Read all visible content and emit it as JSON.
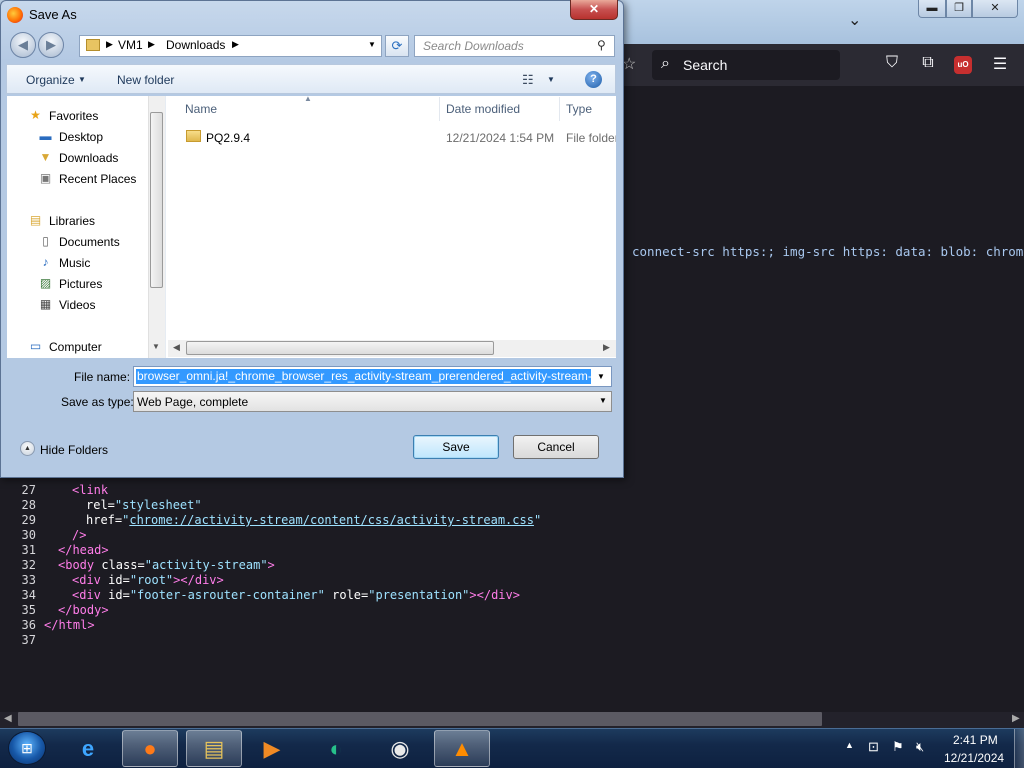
{
  "firefox": {
    "search_placeholder": "Search",
    "csp_text": "connect-src https:; img-src https: data: blob: chrome:;",
    "source_lines": [
      {
        "num": "27",
        "parts": [
          [
            "tag",
            "<link"
          ]
        ],
        "indent": 2
      },
      {
        "num": "28",
        "parts": [
          [
            "attr",
            "rel="
          ],
          [
            "val",
            "\"stylesheet\""
          ]
        ],
        "indent": 3
      },
      {
        "num": "29",
        "parts": [
          [
            "attr",
            "href="
          ],
          [
            "val",
            "\""
          ],
          [
            "link",
            "chrome://activity-stream/content/css/activity-stream.css"
          ],
          [
            "val",
            "\""
          ]
        ],
        "indent": 3
      },
      {
        "num": "30",
        "parts": [
          [
            "tag",
            "/>"
          ]
        ],
        "indent": 2
      },
      {
        "num": "31",
        "parts": [
          [
            "tag",
            "</head>"
          ]
        ],
        "indent": 1
      },
      {
        "num": "32",
        "parts": [
          [
            "tag",
            "<body "
          ],
          [
            "attr",
            "class="
          ],
          [
            "val",
            "\"activity-stream\""
          ],
          [
            "tag",
            ">"
          ]
        ],
        "indent": 1
      },
      {
        "num": "33",
        "parts": [
          [
            "tag",
            "<div "
          ],
          [
            "attr",
            "id="
          ],
          [
            "val",
            "\"root\""
          ],
          [
            "tag",
            "></div>"
          ]
        ],
        "indent": 2
      },
      {
        "num": "34",
        "parts": [
          [
            "tag",
            "<div "
          ],
          [
            "attr",
            "id="
          ],
          [
            "val",
            "\"footer-asrouter-container\""
          ],
          [
            "attr",
            " role="
          ],
          [
            "val",
            "\"presentation\""
          ],
          [
            "tag",
            "></div>"
          ]
        ],
        "indent": 2
      },
      {
        "num": "35",
        "parts": [
          [
            "tag",
            "</body>"
          ]
        ],
        "indent": 1
      },
      {
        "num": "36",
        "parts": [
          [
            "tag",
            "</html>"
          ]
        ],
        "indent": 0
      },
      {
        "num": "37",
        "parts": [],
        "indent": 0
      }
    ]
  },
  "dialog": {
    "title": "Save As",
    "breadcrumb": [
      "VM1",
      "Downloads"
    ],
    "search_placeholder": "Search Downloads",
    "organize_label": "Organize",
    "new_folder_label": "New folder",
    "nav": {
      "favorites_label": "Favorites",
      "favorites": [
        "Desktop",
        "Downloads",
        "Recent Places"
      ],
      "libraries_label": "Libraries",
      "libraries": [
        "Documents",
        "Music",
        "Pictures",
        "Videos"
      ],
      "computer_label": "Computer"
    },
    "columns": [
      "Name",
      "Date modified",
      "Type"
    ],
    "files": [
      {
        "name": "PQ2.9.4",
        "date": "12/21/2024 1:54 PM",
        "type": "File folder"
      }
    ],
    "file_name_label": "File name:",
    "file_name_value": "browser_omni.ja!_chrome_browser_res_activity-stream_prerendered_activity-stream-n",
    "save_type_label": "Save as type:",
    "save_type_value": "Web Page, complete",
    "hide_folders_label": "Hide Folders",
    "save_label": "Save",
    "cancel_label": "Cancel"
  },
  "taskbar": {
    "time": "2:41 PM",
    "date": "12/21/2024"
  },
  "colors": {
    "accent": "#3399ff",
    "taskbar": "#13294a",
    "ff_toolbar": "#2b2a33"
  }
}
